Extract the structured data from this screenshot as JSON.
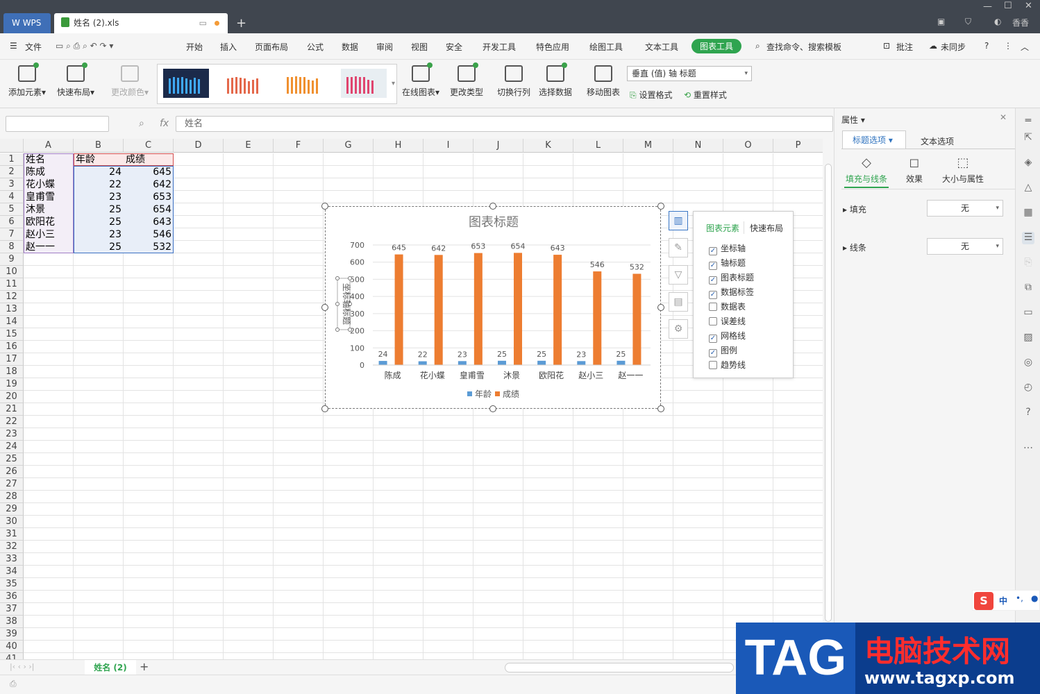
{
  "titlebar": {
    "app_tab": "WPS",
    "file_tab": "姓名 (2).xls",
    "user": "香香"
  },
  "menu": {
    "file": "文件",
    "items": [
      "开始",
      "插入",
      "页面布局",
      "公式",
      "数据",
      "审阅",
      "视图",
      "安全",
      "开发工具",
      "特色应用",
      "绘图工具",
      "文本工具",
      "图表工具"
    ],
    "search": "查找命令、搜索模板",
    "comment": "批注",
    "sync": "未同步"
  },
  "ribbon": {
    "add_element": "添加元素",
    "quick_layout": "快速布局",
    "change_color": "更改颜色",
    "online_chart": "在线图表",
    "change_type": "更改类型",
    "switch_rowcol": "切换行列",
    "select_data": "选择数据",
    "move_chart": "移动图表",
    "axis_selector": "垂直 (值) 轴 标题",
    "set_format": "设置格式",
    "reset_style": "重置样式"
  },
  "formula": {
    "fx": "fx",
    "content": "姓名"
  },
  "columns": [
    "A",
    "B",
    "C",
    "D",
    "E",
    "F",
    "G",
    "H",
    "I",
    "J",
    "K",
    "L",
    "M",
    "N",
    "O",
    "P"
  ],
  "rows": [
    "1",
    "2",
    "3",
    "4",
    "5",
    "6",
    "7",
    "8",
    "9",
    "10",
    "11",
    "12",
    "13",
    "14",
    "15",
    "16",
    "17",
    "18",
    "19",
    "20",
    "21",
    "22",
    "23",
    "24",
    "25",
    "26",
    "27",
    "28",
    "29",
    "30",
    "31",
    "32",
    "33",
    "34",
    "35",
    "36",
    "37",
    "38",
    "39",
    "40",
    "41"
  ],
  "table": {
    "headers": [
      "姓名",
      "年龄",
      "成绩"
    ],
    "data": [
      [
        "陈成",
        "24",
        "645"
      ],
      [
        "花小蝶",
        "22",
        "642"
      ],
      [
        "皇甫雪",
        "23",
        "653"
      ],
      [
        "沐景",
        "25",
        "654"
      ],
      [
        "欧阳花",
        "25",
        "643"
      ],
      [
        "赵小三",
        "23",
        "546"
      ],
      [
        "赵一一",
        "25",
        "532"
      ]
    ]
  },
  "chart_data": {
    "type": "bar",
    "title": "图表标题",
    "ylabel": "坐标轴标题",
    "xlabel": "",
    "categories": [
      "陈成",
      "花小蝶",
      "皇甫雪",
      "沐景",
      "欧阳花",
      "赵小三",
      "赵一一"
    ],
    "series": [
      {
        "name": "年龄",
        "values": [
          24,
          22,
          23,
          25,
          25,
          23,
          25
        ],
        "color": "#5b9bd5"
      },
      {
        "name": "成绩",
        "values": [
          645,
          642,
          653,
          654,
          643,
          546,
          532
        ],
        "color": "#ed7d31"
      }
    ],
    "ylim": [
      0,
      700
    ],
    "yticks": [
      "0",
      "100",
      "200",
      "300",
      "400",
      "500",
      "600",
      "700"
    ],
    "grid": true,
    "legend": "bottom"
  },
  "element_panel": {
    "tab_elements": "图表元素",
    "tab_layout": "快速布局",
    "items": [
      {
        "label": "坐标轴",
        "checked": true
      },
      {
        "label": "轴标题",
        "checked": true
      },
      {
        "label": "图表标题",
        "checked": true
      },
      {
        "label": "数据标签",
        "checked": true
      },
      {
        "label": "数据表",
        "checked": false
      },
      {
        "label": "误差线",
        "checked": false
      },
      {
        "label": "网格线",
        "checked": true
      },
      {
        "label": "图例",
        "checked": true
      },
      {
        "label": "趋势线",
        "checked": false
      }
    ]
  },
  "properties": {
    "header": "属性",
    "tab_title": "标题选项",
    "tab_text": "文本选项",
    "sub_fill_line": "填充与线条",
    "sub_effect": "效果",
    "sub_size": "大小与属性",
    "fill_label": "填充",
    "fill_value": "无",
    "line_label": "线条",
    "line_value": "无"
  },
  "sheet": {
    "tab": "姓名 (2)"
  },
  "ime": {
    "lang": "中"
  },
  "watermark": {
    "tag": "TAG",
    "title": "电脑技术网",
    "url": "www.tagxp.com"
  },
  "colors": {
    "accent": "#2fa44f",
    "titlebar": "#40464f",
    "bar_age": "#5b9bd5",
    "bar_score": "#ed7d31"
  }
}
